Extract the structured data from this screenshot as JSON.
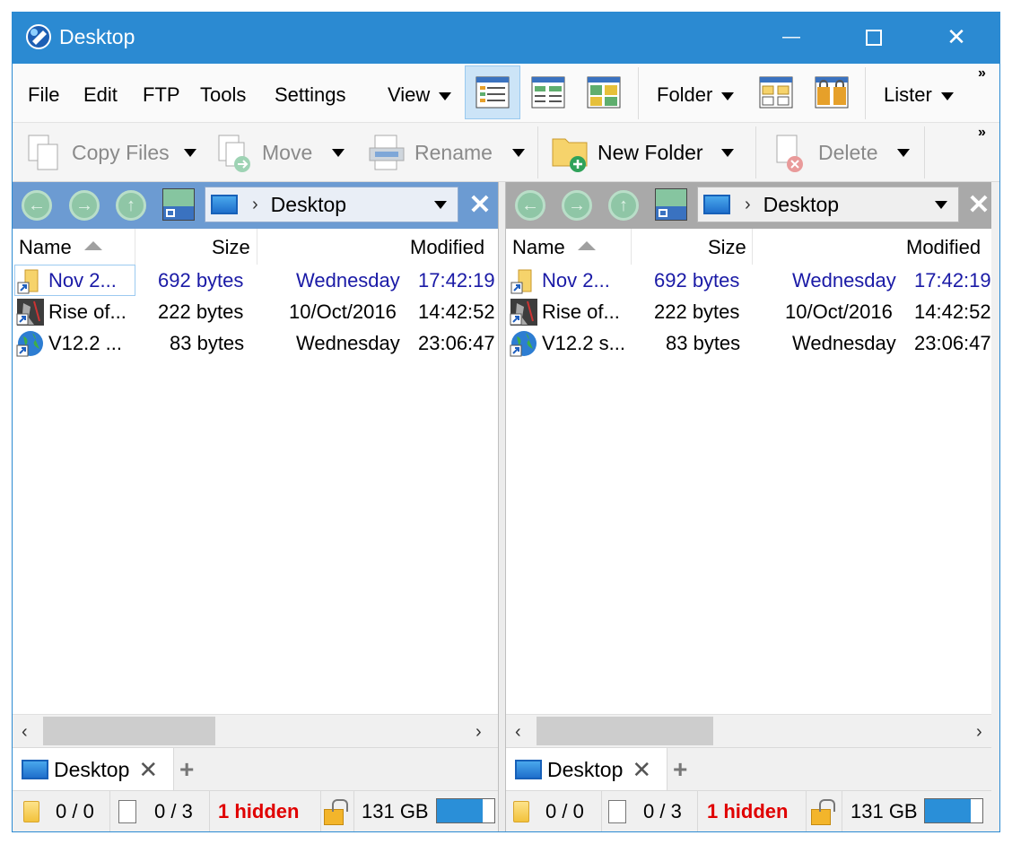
{
  "window": {
    "title": "Desktop",
    "controls": {
      "minimize": "—",
      "maximize": "☐",
      "close": "✕"
    }
  },
  "menu": {
    "file": "File",
    "edit": "Edit",
    "ftp": "FTP",
    "tools": "Tools",
    "settings": "Settings",
    "view": "View",
    "folder": "Folder",
    "lister": "Lister",
    "overflow": "»"
  },
  "toolbar": {
    "copy_files": "Copy Files",
    "move": "Move",
    "rename": "Rename",
    "new_folder": "New Folder",
    "delete": "Delete",
    "overflow": "»"
  },
  "columns": {
    "name": "Name",
    "size": "Size",
    "modified": "Modified"
  },
  "panes": {
    "left": {
      "path": "Desktop",
      "files": [
        {
          "name": "Nov 2...",
          "size": "692 bytes",
          "date": "Wednesday",
          "time": "17:42:19",
          "icon": "folder-shortcut-icon"
        },
        {
          "name": "Rise of...",
          "size": "222 bytes",
          "date": "10/Oct/2016",
          "time": "14:42:52",
          "icon": "game-shortcut-icon"
        },
        {
          "name": "V12.2 ...",
          "size": "83 bytes",
          "date": "Wednesday",
          "time": "23:06:47",
          "icon": "globe-shortcut-icon"
        }
      ],
      "tab": "Desktop",
      "status": {
        "dirs": "0 / 0",
        "files": "0 / 3",
        "hidden": "1 hidden",
        "free": "131 GB",
        "used_fraction": 0.8
      }
    },
    "right": {
      "path": "Desktop",
      "files": [
        {
          "name": "Nov 2...",
          "size": "692 bytes",
          "date": "Wednesday",
          "time": "17:42:19",
          "icon": "folder-shortcut-icon"
        },
        {
          "name": "Rise of...",
          "size": "222 bytes",
          "date": "10/Oct/2016",
          "time": "14:42:52",
          "icon": "game-shortcut-icon"
        },
        {
          "name": "V12.2 s...",
          "size": "83 bytes",
          "date": "Wednesday",
          "time": "23:06:47",
          "icon": "globe-shortcut-icon"
        }
      ],
      "tab": "Desktop",
      "status": {
        "dirs": "0 / 0",
        "files": "0 / 3",
        "hidden": "1 hidden",
        "free": "131 GB",
        "used_fraction": 0.8
      }
    }
  },
  "tab_add": "+",
  "colors": {
    "titlebar": "#2b8ad2",
    "left_path": "#6c9bd2",
    "right_path": "#a9a9a9",
    "hidden_text": "#e00000",
    "link_blue": "#1a1aa6"
  }
}
